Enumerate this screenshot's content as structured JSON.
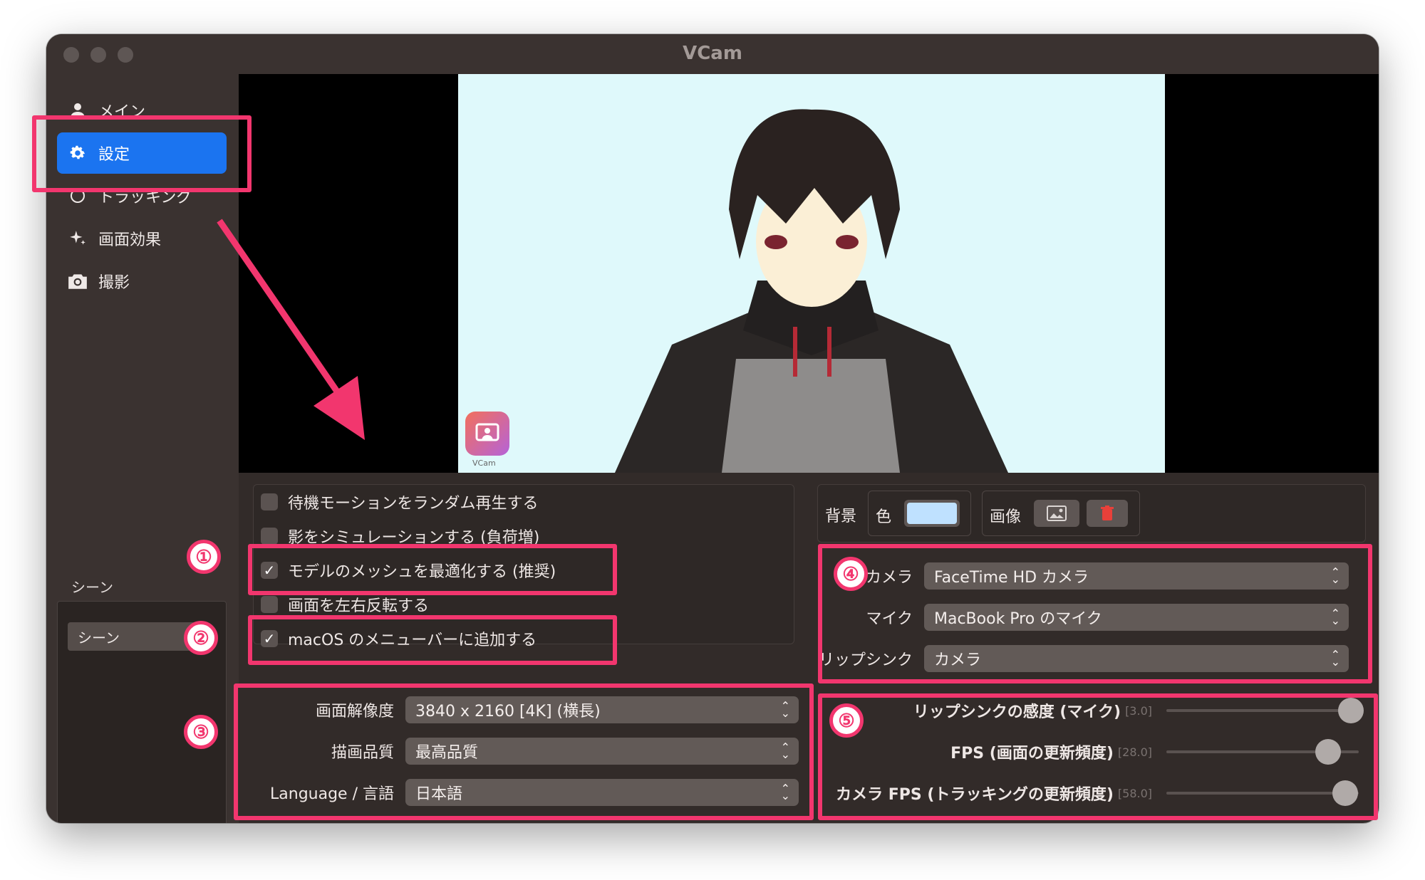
{
  "window": {
    "title": "VCam"
  },
  "sidebar": {
    "items": [
      {
        "label": "メイン",
        "icon": "person-icon"
      },
      {
        "label": "設定",
        "icon": "gear-icon",
        "active": true
      },
      {
        "label": "トラッキング",
        "icon": "tracking-icon"
      },
      {
        "label": "画面効果",
        "icon": "sparkle-icon"
      },
      {
        "label": "撮影",
        "icon": "camera-icon"
      }
    ],
    "scene_label": "シーン",
    "scenes": [
      "シーン"
    ],
    "scene_controls": [
      "+",
      "−",
      "∧",
      "∨"
    ]
  },
  "preview": {
    "logo_text": "VCam"
  },
  "options": {
    "items": [
      {
        "label": "待機モーションをランダム再生する",
        "checked": false
      },
      {
        "label": "影をシミュレーションする (負荷増)",
        "checked": false
      },
      {
        "label": "モデルのメッシュを最適化する (推奨)",
        "checked": true
      },
      {
        "label": "画面を左右反転する",
        "checked": false
      },
      {
        "label": "macOS のメニューバーに追加する",
        "checked": true
      }
    ]
  },
  "display": {
    "resolution_label": "画面解像度",
    "resolution_value": "3840 x 2160 [4K] (横長)",
    "quality_label": "描画品質",
    "quality_value": "最高品質",
    "language_label": "Language / 言語",
    "language_value": "日本語"
  },
  "background": {
    "label": "背景",
    "color_label": "色",
    "color_value": "#bfe1ff",
    "image_label": "画像"
  },
  "devices": {
    "camera_label": "カメラ",
    "camera_value": "FaceTime HD カメラ",
    "mic_label": "マイク",
    "mic_value": "MacBook Pro のマイク",
    "lipsync_label": "リップシンク",
    "lipsync_value": "カメラ"
  },
  "sliders": [
    {
      "label": "リップシンクの感度 (マイク)",
      "value_text": "[3.0]",
      "level": 0.96
    },
    {
      "label": "FPS (画面の更新頻度)",
      "value_text": "[28.0]",
      "level": 0.84
    },
    {
      "label": "カメラ FPS (トラッキングの更新頻度)",
      "value_text": "[58.0]",
      "level": 0.93
    }
  ],
  "annotations": {
    "badges": [
      "①",
      "②",
      "③",
      "④",
      "⑤"
    ],
    "accent": "#f2366e"
  }
}
